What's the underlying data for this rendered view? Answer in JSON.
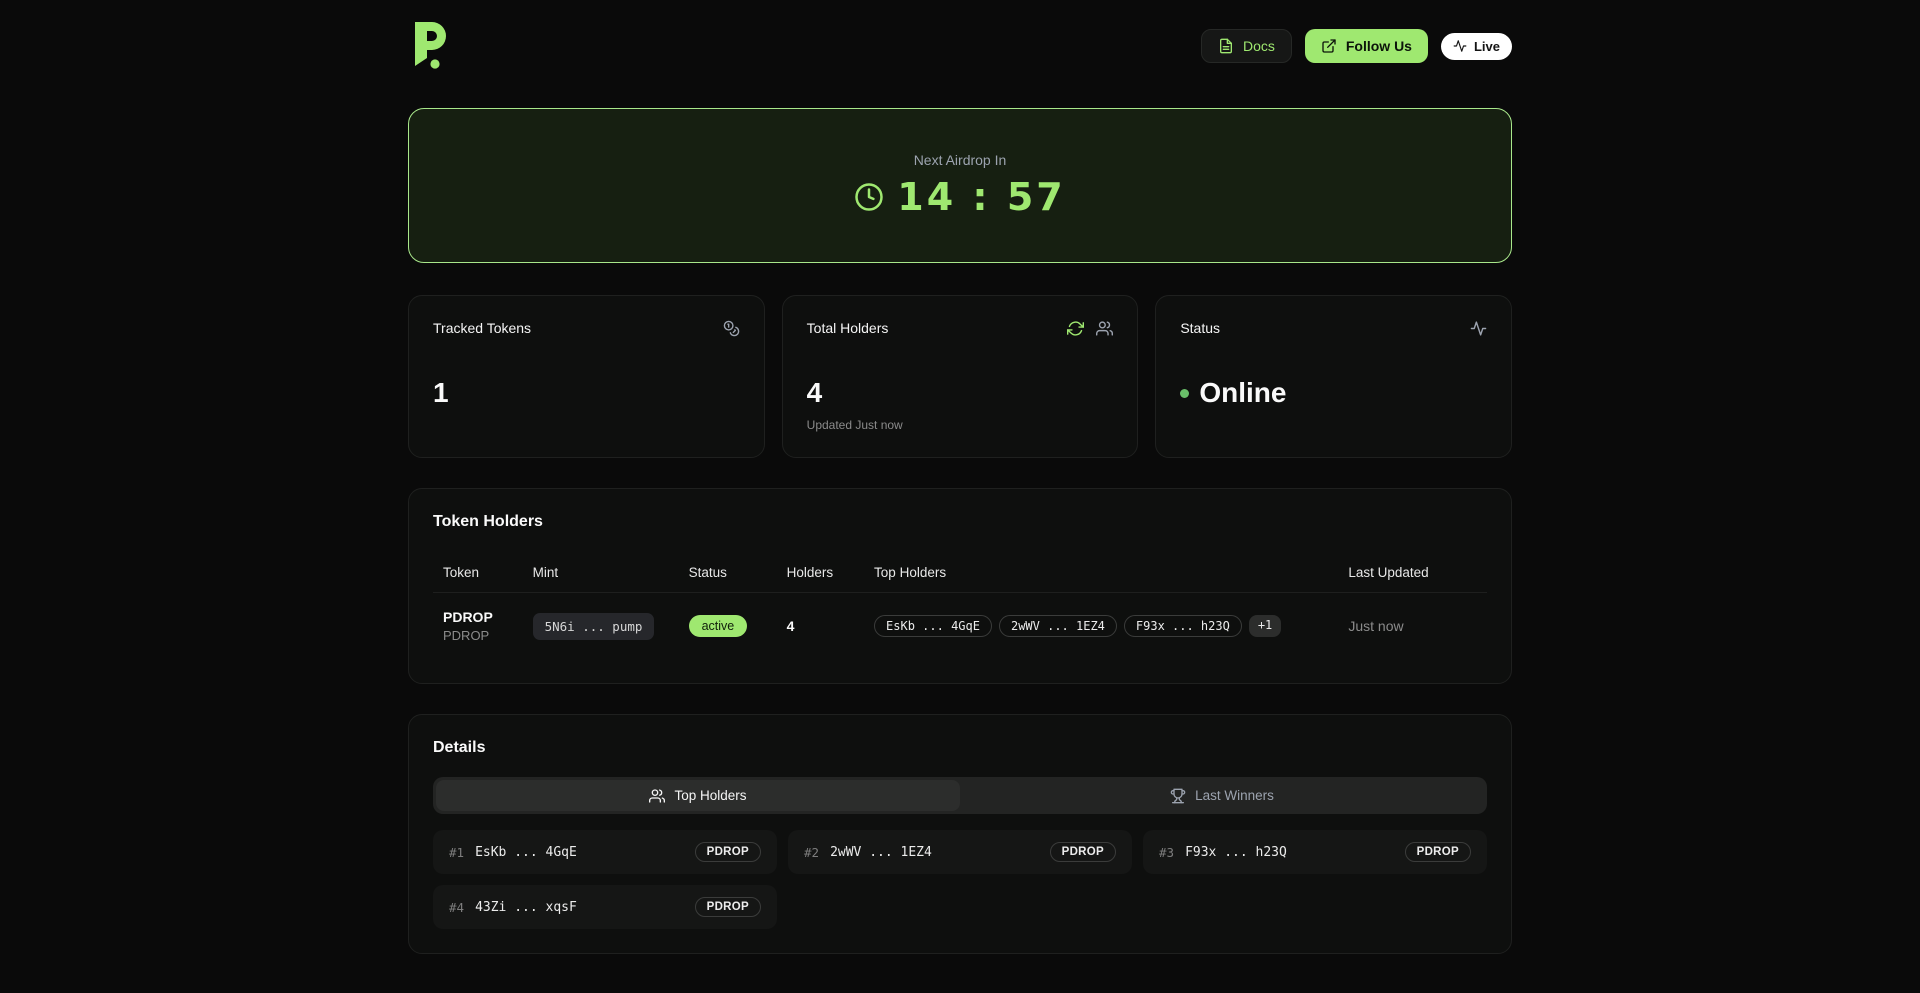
{
  "colors": {
    "accent": "#9fe870",
    "banner_border": "#a9e88b",
    "banner_bg": "#161f11",
    "online_dot": "#6abf69"
  },
  "header": {
    "docs_label": "Docs",
    "follow_label": "Follow Us",
    "live_label": "Live"
  },
  "airdrop": {
    "label": "Next Airdrop In",
    "countdown": "14 : 57"
  },
  "stats": {
    "tracked": {
      "title": "Tracked Tokens",
      "value": "1"
    },
    "holders": {
      "title": "Total Holders",
      "value": "4",
      "updated": "Updated Just now"
    },
    "status": {
      "title": "Status",
      "value": "Online"
    }
  },
  "token_table": {
    "title": "Token Holders",
    "columns": [
      "Token",
      "Mint",
      "Status",
      "Holders",
      "Top Holders",
      "Last Updated"
    ],
    "rows": [
      {
        "token": "PDROP",
        "token_sub": "PDROP",
        "mint": "5N6i ... pump",
        "status": "active",
        "holders": "4",
        "top_holders": [
          "EsKb ... 4GqE",
          "2wWV ... 1EZ4",
          "F93x ... h23Q"
        ],
        "more": "+1",
        "last_updated": "Just now"
      }
    ]
  },
  "details": {
    "title": "Details",
    "tabs": [
      {
        "label": "Top Holders",
        "active": true
      },
      {
        "label": "Last Winners",
        "active": false
      }
    ],
    "holders": [
      {
        "rank": "#1",
        "address": "EsKb ... 4GqE",
        "token": "PDROP"
      },
      {
        "rank": "#2",
        "address": "2wWV ... 1EZ4",
        "token": "PDROP"
      },
      {
        "rank": "#3",
        "address": "F93x ... h23Q",
        "token": "PDROP"
      },
      {
        "rank": "#4",
        "address": "43Zi ... xqsF",
        "token": "PDROP"
      }
    ]
  }
}
